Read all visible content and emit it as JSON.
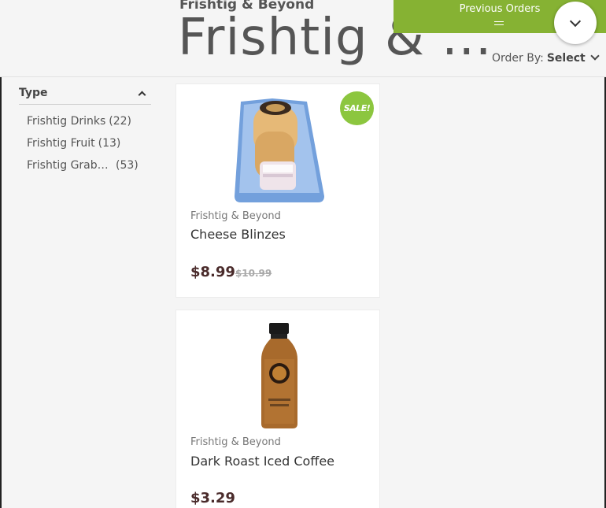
{
  "header": {
    "store_small": "Frishtig & Beyond",
    "store_big": "Frishtig & ...",
    "previous_orders": "Previous Orders",
    "order_by_label": "Order By:",
    "order_by_value": "Select"
  },
  "sidebar": {
    "type_label": "Type",
    "filters": [
      {
        "name": "Frishtig Drinks",
        "count": "(22)"
      },
      {
        "name": "Frishtig Fruit",
        "count": "(13)"
      },
      {
        "name": "Frishtig Grab ...",
        "count": "(53)"
      }
    ]
  },
  "products": [
    {
      "brand": "Frishtig & Beyond",
      "name": "Cheese Blinzes",
      "price": "$8.99",
      "old_price": "$10.99",
      "badge": "SALE!"
    },
    {
      "brand": "Frishtig & Beyond",
      "name": "Dark Roast Iced Coffee",
      "price": "$3.29"
    }
  ],
  "colors": {
    "accent": "#86b233",
    "price": "#4a2b2b"
  }
}
